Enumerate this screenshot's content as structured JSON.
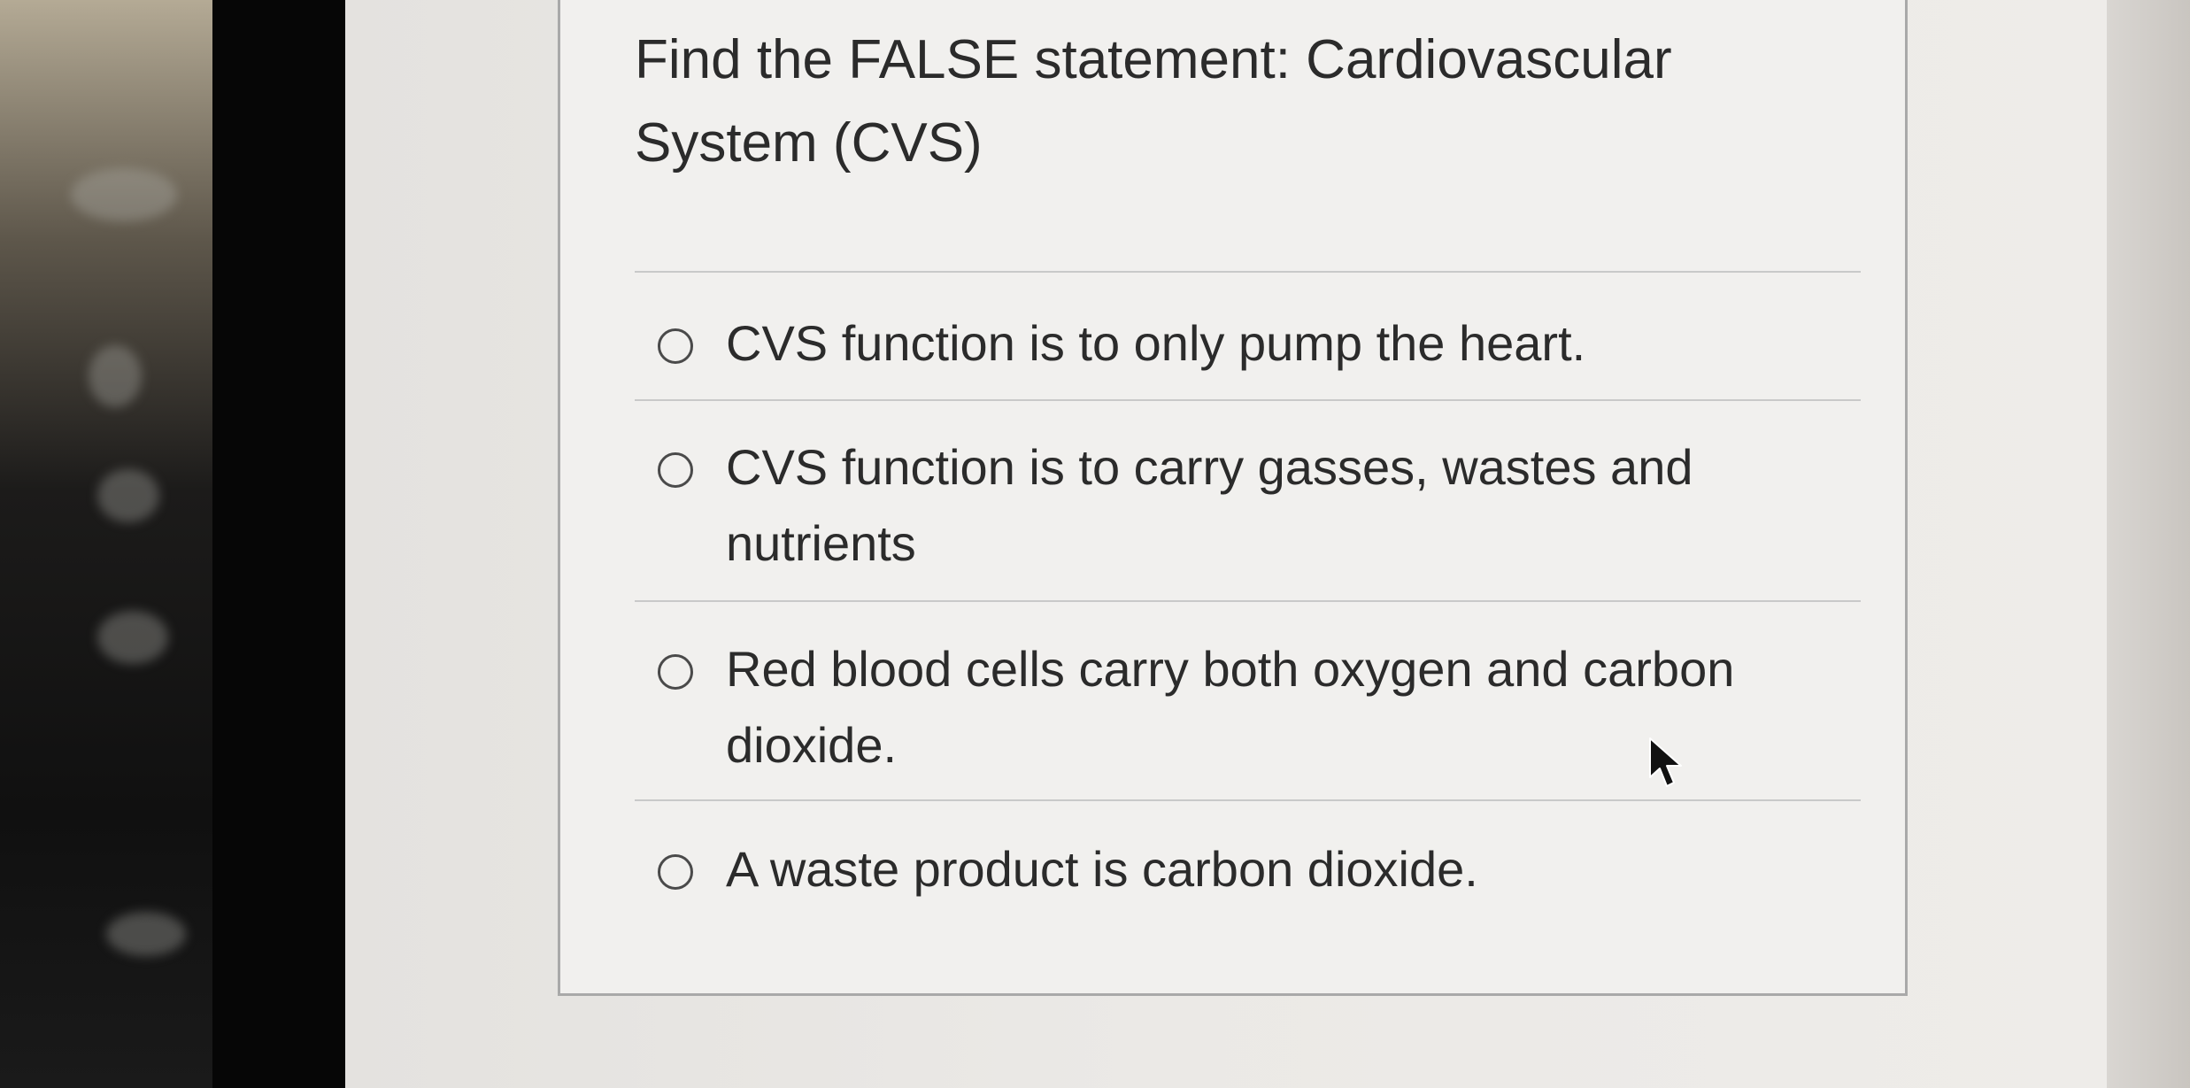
{
  "question": {
    "title": "Find the FALSE statement: Cardiovascular System (CVS)"
  },
  "options": [
    {
      "label": "CVS function is to only pump the heart."
    },
    {
      "label": "CVS function is to carry gasses, wastes and nutrients"
    },
    {
      "label": "Red blood cells carry both oxygen and carbon dioxide."
    },
    {
      "label": "A waste product is carbon dioxide."
    }
  ],
  "icons": {
    "radio": "radio-button-unselected-icon",
    "cursor": "mouse-pointer-icon"
  },
  "colors": {
    "card_background": "#f1f0ee",
    "card_border": "#a9a9a9",
    "text": "#2b2b2b"
  }
}
